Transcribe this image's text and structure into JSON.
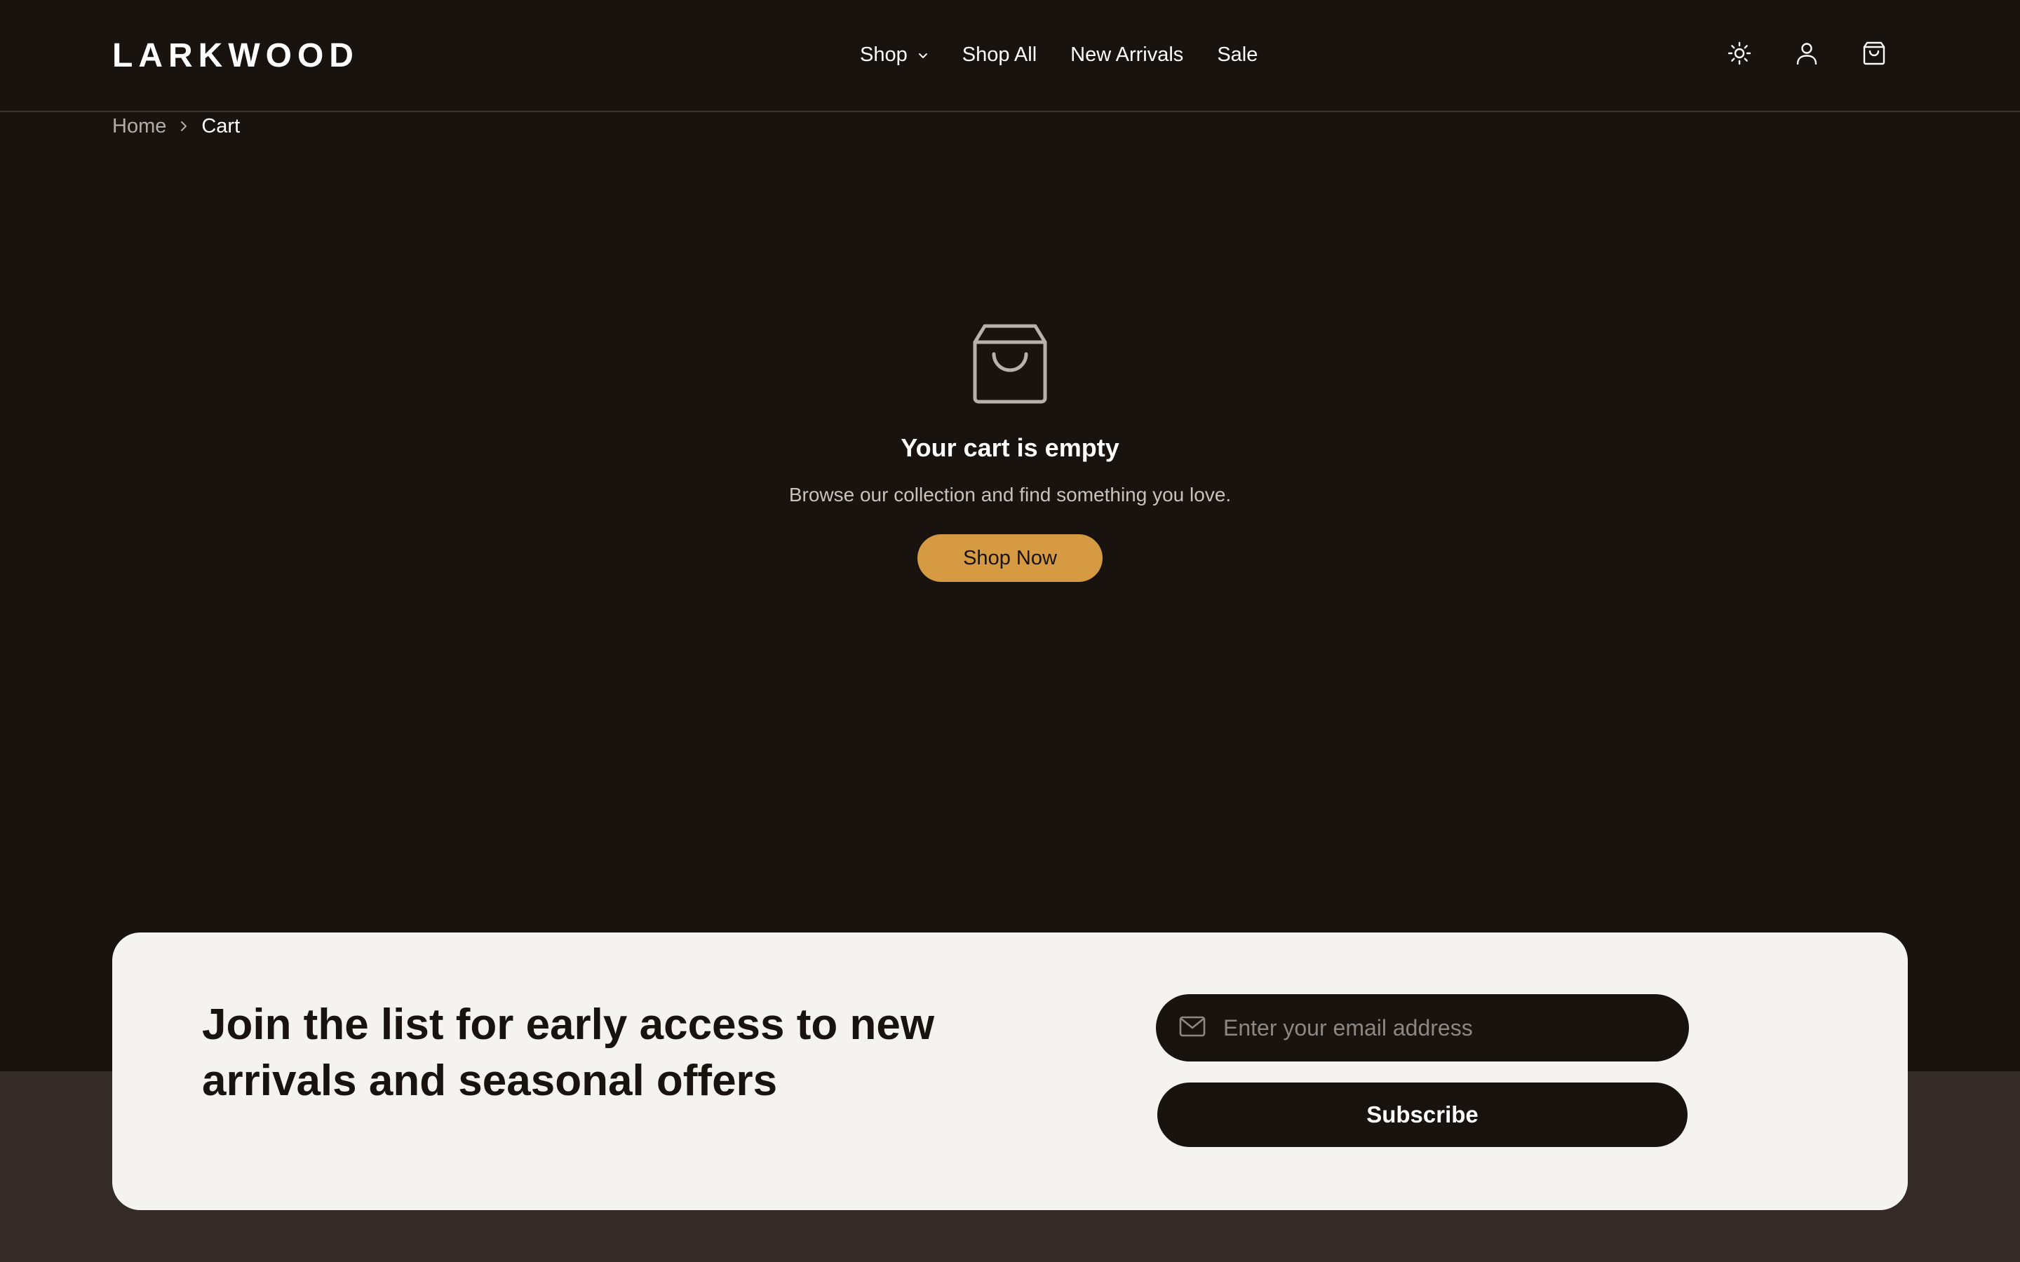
{
  "header": {
    "logo": "LARKWOOD",
    "nav": {
      "shop": "Shop",
      "shop_all": "Shop All",
      "new_arrivals": "New Arrivals",
      "sale": "Sale"
    },
    "icons": [
      "sun-icon",
      "user-icon",
      "cart-icon"
    ]
  },
  "breadcrumb": {
    "home": "Home",
    "current": "Cart"
  },
  "empty_state": {
    "icon": "shopping-bag-icon",
    "title": "Your cart is empty",
    "subtitle": "Browse our collection and find something you love.",
    "button": "Shop Now"
  },
  "newsletter": {
    "title": "Join the list for early access to new arrivals and seasonal offers",
    "email_placeholder": "Enter your email address",
    "email_icon": "mail-icon",
    "subscribe_label": "Subscribe"
  },
  "colors": {
    "background": "#19130f",
    "accent": "#d69a43",
    "card": "#f4f3ef",
    "footer": "#342b27"
  }
}
